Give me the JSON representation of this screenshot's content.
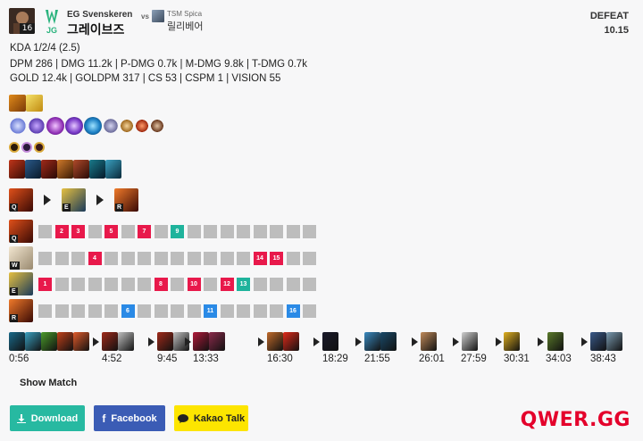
{
  "header": {
    "champion_level": "16",
    "role": "JG",
    "player_team": "EG Svenskeren",
    "player_name": "그레이브즈",
    "vs_label": "vs",
    "opponent_team": "TSM Spica",
    "opponent_name": "릴리베어",
    "result": "DEFEAT",
    "patch": "10.15"
  },
  "stats": {
    "line1": "KDA 1/2/4 (2.5)",
    "line2": "DPM 286 | DMG 11.2k | P-DMG 0.7k | M-DMG 9.8k | T-DMG 0.7k",
    "line3": "GOLD 12.4k | GOLDPM 317 | CS 53 | CSPM 1 | VISION 55"
  },
  "skill_order": [
    {
      "key": "Q",
      "color": "#c0392b"
    },
    {
      "key": "E",
      "color": "#2a4d6e"
    },
    {
      "key": "R",
      "color": "#b03a1e"
    }
  ],
  "skill_grid": [
    {
      "key": "Q",
      "color": "#b2321c",
      "levels": [
        "",
        "2",
        "3",
        "",
        "5",
        "",
        "7",
        "",
        "9",
        "",
        "",
        "",
        "",
        "",
        "",
        "",
        ""
      ]
    },
    {
      "key": "W",
      "color": "#c9b9a0",
      "levels": [
        "",
        "",
        "",
        "4",
        "",
        "",
        "",
        "",
        "",
        "",
        "",
        "",
        "",
        "14",
        "15",
        "",
        ""
      ]
    },
    {
      "key": "E",
      "color": "#2b4a6e",
      "levels": [
        "1",
        "",
        "",
        "",
        "",
        "",
        "",
        "8",
        "",
        "10",
        "",
        "12",
        "13",
        "",
        "",
        "",
        ""
      ]
    },
    {
      "key": "R",
      "color": "#a5311b",
      "levels": [
        "",
        "",
        "",
        "",
        "",
        "6",
        "",
        "",
        "",
        "",
        "11",
        "",
        "",
        "",
        "",
        "16",
        ""
      ]
    }
  ],
  "timeline": [
    {
      "time": "0:56"
    },
    {
      "time": "4:52"
    },
    {
      "time": "9:45"
    },
    {
      "time": "13:33"
    },
    {
      "time": "16:30"
    },
    {
      "time": "18:29"
    },
    {
      "time": "21:55"
    },
    {
      "time": "26:01"
    },
    {
      "time": "27:59"
    },
    {
      "time": "30:31"
    },
    {
      "time": "34:03"
    },
    {
      "time": "38:43"
    }
  ],
  "colors": {
    "max_skill": "#e8194b",
    "mid_skill": "#1fb39c",
    "ult_skill": "#2a8ae6",
    "empty": "#bdbdbd"
  },
  "actions": {
    "show_match": "Show Match",
    "download": "Download",
    "facebook": "Facebook",
    "kakao": "Kakao Talk"
  },
  "brand": "QWER.GG"
}
